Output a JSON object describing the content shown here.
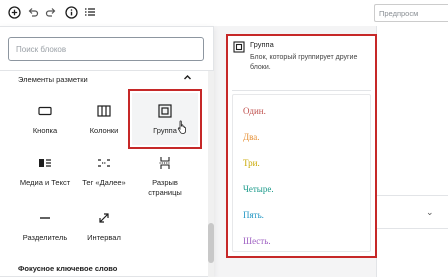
{
  "toolbar": {
    "preview_label": "Предпросм",
    "icons": [
      "add-icon",
      "undo-icon",
      "redo-icon",
      "info-icon",
      "list-view-icon"
    ]
  },
  "inserter": {
    "search_placeholder": "Поиск блоков",
    "category_title": "Элементы разметки",
    "blocks": [
      {
        "label": "Кнопка",
        "icon": "button-icon"
      },
      {
        "label": "Колонки",
        "icon": "columns-icon"
      },
      {
        "label": "Группа",
        "icon": "group-icon"
      },
      {
        "label": "Медиа и Текст",
        "icon": "media-text-icon"
      },
      {
        "label": "Тег «Далее»",
        "icon": "more-tag-icon"
      },
      {
        "label_line1": "Разрыв",
        "label_line2": "страницы",
        "icon": "page-break-icon"
      },
      {
        "label": "Разделитель",
        "icon": "separator-icon"
      },
      {
        "label": "Интервал",
        "icon": "spacer-icon"
      }
    ]
  },
  "preview": {
    "title": "Группа",
    "description": "Блок, который группирует другие блоки.",
    "items": [
      {
        "text": "Один.",
        "color": "#c0504d"
      },
      {
        "text": "Два.",
        "color": "#e69138"
      },
      {
        "text": "Три.",
        "color": "#c9a800"
      },
      {
        "text": "Четыре.",
        "color": "#1a9a8a"
      },
      {
        "text": "Пять.",
        "color": "#2196c4"
      },
      {
        "text": "Шесть.",
        "color": "#9e5fc2"
      }
    ]
  },
  "editor": {
    "bottom_label": "Фокусное ключевое слово"
  },
  "colors": {
    "highlight": "#c62828"
  }
}
